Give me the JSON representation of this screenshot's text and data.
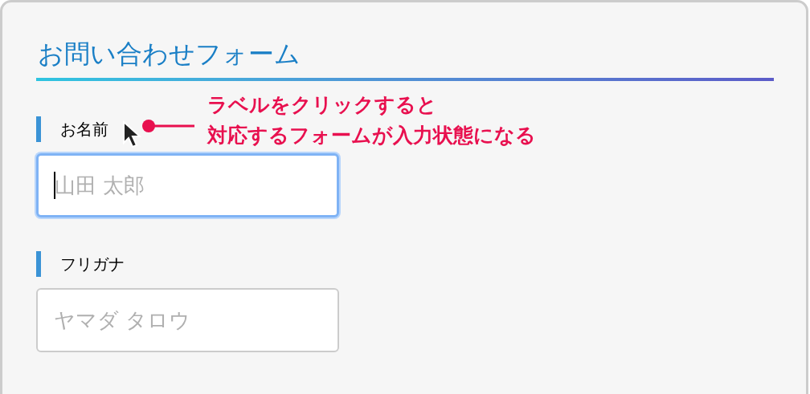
{
  "form": {
    "title": "お問い合わせフォーム",
    "fields": [
      {
        "label": "お名前",
        "placeholder": "山田 太郎",
        "focused": true
      },
      {
        "label": "フリガナ",
        "placeholder": "ヤマダ タロウ",
        "focused": false
      }
    ]
  },
  "annotation": {
    "lines": [
      "ラベルをクリックすると",
      "対応するフォームが入力状態になる"
    ]
  }
}
